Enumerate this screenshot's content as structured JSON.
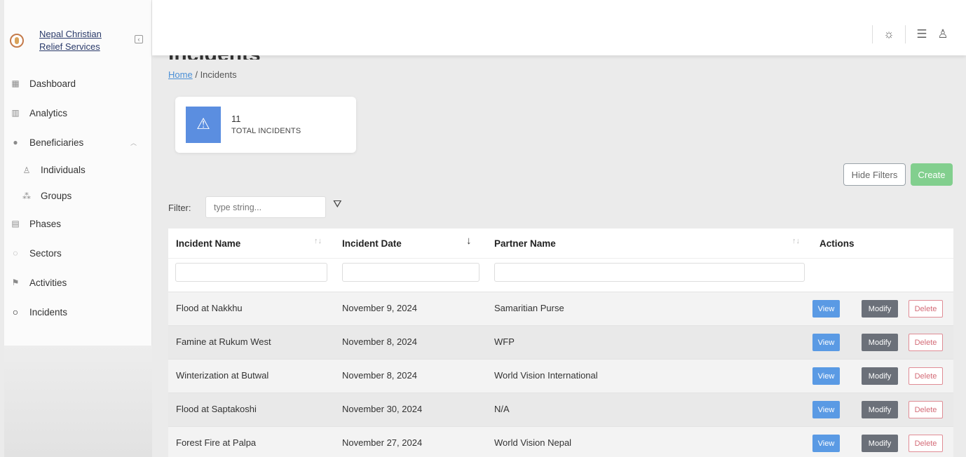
{
  "brand": {
    "name_line1": "Nepal Christian",
    "name_line2": "Relief Services"
  },
  "sidebar": {
    "items": [
      {
        "label": "Dashboard",
        "icon": "dashboard-icon",
        "glyph": "▦"
      },
      {
        "label": "Analytics",
        "icon": "analytics-icon",
        "glyph": "▥"
      },
      {
        "label": "Beneficiaries",
        "icon": "user-icon",
        "glyph": "●"
      },
      {
        "label": "Individuals",
        "icon": "person-outline-icon",
        "glyph": "♙"
      },
      {
        "label": "Groups",
        "icon": "group-icon",
        "glyph": "⁂"
      },
      {
        "label": "Phases",
        "icon": "calendar-icon",
        "glyph": "▤"
      },
      {
        "label": "Sectors",
        "icon": "circle-dashed-icon",
        "glyph": "◌"
      },
      {
        "label": "Activities",
        "icon": "activity-icon",
        "glyph": "⚑"
      },
      {
        "label": "Incidents",
        "icon": "circle-notch-icon",
        "glyph": "○"
      }
    ]
  },
  "header": {
    "theme_icon": "sun-icon",
    "menu_icon": "list-icon",
    "user_icon": "user-outline-icon"
  },
  "page": {
    "title": "Incidents"
  },
  "breadcrumb": {
    "home": "Home",
    "sep": "/",
    "current": "Incidents"
  },
  "stat": {
    "value": "11",
    "label": "TOTAL INCIDENTS",
    "icon": "warning-icon"
  },
  "actions": {
    "hide_filters": "Hide Filters",
    "create": "Create"
  },
  "filter": {
    "label": "Filter:",
    "placeholder": "type string..."
  },
  "table": {
    "columns": {
      "name": "Incident Name",
      "date": "Incident Date",
      "partner": "Partner Name",
      "actions": "Actions"
    },
    "buttons": {
      "view": "View",
      "modify": "Modify",
      "delete": "Delete"
    },
    "rows": [
      {
        "name": "Flood at Nakkhu",
        "date": "November 9, 2024",
        "partner": "Samaritian Purse"
      },
      {
        "name": "Famine at Rukum West",
        "date": "November 8, 2024",
        "partner": "WFP"
      },
      {
        "name": "Winterization at Butwal",
        "date": "November 8, 2024",
        "partner": "World Vision International"
      },
      {
        "name": "Flood at Saptakoshi",
        "date": "November 30, 2024",
        "partner": "N/A"
      },
      {
        "name": "Forest Fire at Palpa",
        "date": "November 27, 2024",
        "partner": "World Vision Nepal"
      }
    ]
  }
}
